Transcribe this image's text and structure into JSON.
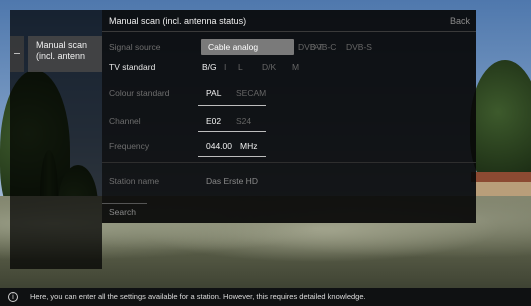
{
  "left_menu": {
    "active_item_lines": [
      "Manual scan",
      "(incl. antenn"
    ]
  },
  "dialog": {
    "title": "Manual scan (incl. antenna status)",
    "back_label": "Back",
    "rows": {
      "signal_source": {
        "label": "Signal source",
        "options": [
          "Cable analog",
          "DVB-T",
          "DVB-C",
          "DVB-S"
        ],
        "selected": "Cable analog"
      },
      "tv_standard": {
        "label": "TV standard",
        "options": [
          "B/G",
          "I",
          "L",
          "D/K",
          "M"
        ],
        "selected": "B/G"
      },
      "colour_standard": {
        "label": "Colour standard",
        "options": [
          "PAL",
          "SECAM"
        ],
        "selected": "PAL"
      },
      "channel": {
        "label": "Channel",
        "options": [
          "E02",
          "S24"
        ],
        "selected": "E02"
      },
      "frequency": {
        "label": "Frequency",
        "value": "044.00",
        "unit": "MHz"
      },
      "station_name": {
        "label": "Station name",
        "value": "Das Erste HD"
      }
    },
    "search_label": "Search"
  },
  "info_bar": {
    "icon": "info-icon",
    "text": "Here, you can enter all the settings available for a station. However, this requires detailed knowledge."
  },
  "colors": {
    "dialog_bg": "#080808",
    "selected_bg": "#7a7a7a",
    "active_text": "#f4f4f4",
    "inactive_text": "#666666"
  }
}
